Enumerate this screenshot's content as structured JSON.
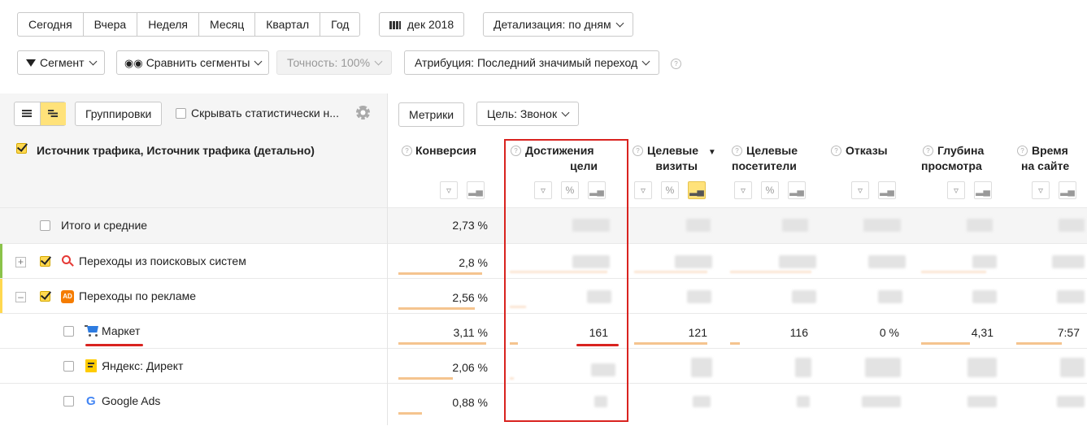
{
  "periods": [
    "Сегодня",
    "Вчера",
    "Неделя",
    "Месяц",
    "Квартал",
    "Год"
  ],
  "date_label": "дек 2018",
  "detail_label": "Детализация: по дням",
  "segment_label": "Сегмент",
  "compare_label": "Сравнить сегменты",
  "accuracy_label": "Точность: 100%",
  "attribution_label": "Атрибуция: Последний значимый переход",
  "groupings_label": "Группировки",
  "hide_stat_label": "Скрывать статистически н...",
  "metrics_label": "Метрики",
  "goal_label": "Цель: Звонок",
  "dimension_header": "Источник трафика, Источник трафика (детально)",
  "columns": {
    "conversion": "Конверсия",
    "goal_reaches_1": "Достижения",
    "goal_reaches_2": "цели",
    "target_visits_1": "Целевые",
    "target_visits_2": "визиты",
    "target_visitors_1": "Целевые",
    "target_visitors_2": "посетители",
    "bounces": "Отказы",
    "depth_1": "Глубина",
    "depth_2": "просмотра",
    "time_1": "Время",
    "time_2": "на сайте"
  },
  "rows": [
    {
      "label": "Итого и средние",
      "conversion": "2,73 %",
      "conv_frac": 0
    },
    {
      "label": "Переходы из поисковых систем",
      "conversion": "2,8 %",
      "conv_frac": 0.92
    },
    {
      "label": "Переходы по рекламе",
      "conversion": "2,56 %",
      "conv_frac": 0.84
    },
    {
      "label": "Маркет",
      "conversion": "3,11 %",
      "conv_frac": 0.96,
      "goals": "161",
      "visits": "121",
      "visitors": "116",
      "bounces": "0 %",
      "depth": "4,31",
      "time": "7:57"
    },
    {
      "label": "Яндекс: Директ",
      "conversion": "2,06 %",
      "conv_frac": 0.6
    },
    {
      "label": "Google Ads",
      "conversion": "0,88 %",
      "conv_frac": 0.26
    }
  ],
  "colors": {
    "accent": "#ffd850",
    "highlight": "#d9231f",
    "conv_bar": "#f5c48f"
  }
}
